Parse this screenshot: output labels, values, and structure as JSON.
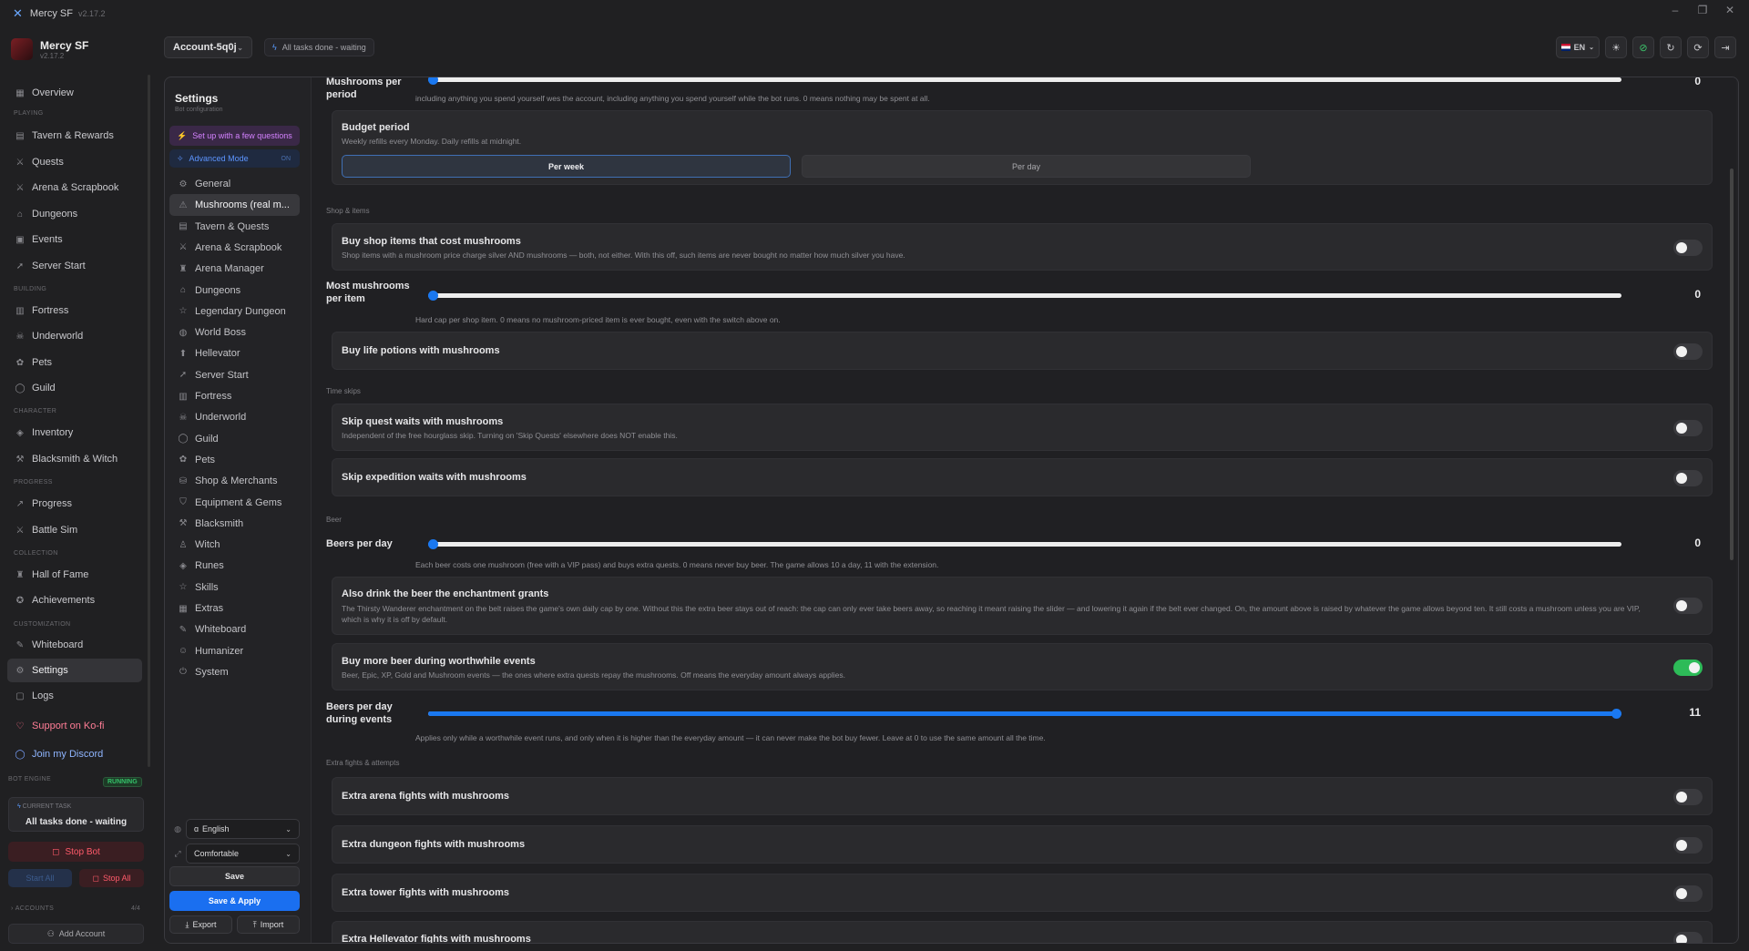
{
  "app": {
    "title": "Mercy SF",
    "version": "v2.17.2"
  },
  "profile": {
    "name": "Mercy SF",
    "version": "v2.17.2"
  },
  "header": {
    "account": "Account-5q0j",
    "status": "All tasks done - waiting",
    "lang": "EN"
  },
  "sidebar": {
    "overview": "Overview",
    "playing": "PLAYING",
    "tavern": "Tavern & Rewards",
    "quests": "Quests",
    "arena": "Arena & Scrapbook",
    "dungeons": "Dungeons",
    "events": "Events",
    "server_start": "Server Start",
    "building": "BUILDING",
    "fortress": "Fortress",
    "underworld": "Underworld",
    "pets": "Pets",
    "guild": "Guild",
    "character": "CHARACTER",
    "inventory": "Inventory",
    "blacksmith": "Blacksmith & Witch",
    "progress_sec": "PROGRESS",
    "progress": "Progress",
    "battle_sim": "Battle Sim",
    "collection": "COLLECTION",
    "hall_of_fame": "Hall of Fame",
    "achievements": "Achievements",
    "customization": "CUSTOMIZATION",
    "whiteboard": "Whiteboard",
    "settings": "Settings",
    "logs": "Logs",
    "kofi": "Support on Ko-fi",
    "discord": "Join my Discord"
  },
  "bot": {
    "engine_label": "BOT ENGINE",
    "running": "RUNNING",
    "current_task_label": "CURRENT TASK",
    "current_task": "All tasks done - waiting",
    "stop_bot": "Stop Bot",
    "start_all": "Start All",
    "stop_all": "Stop All",
    "accounts_label": "ACCOUNTS",
    "accounts_count": "4/4",
    "add_account": "Add Account"
  },
  "settings_nav": {
    "title": "Settings",
    "subtitle": "Bot configuration",
    "setup": "Set up with a few questions",
    "advanced": "Advanced Mode",
    "advanced_state": "ON",
    "items": [
      "General",
      "Mushrooms (real m...",
      "Tavern & Quests",
      "Arena & Scrapbook",
      "Arena Manager",
      "Dungeons",
      "Legendary Dungeon",
      "World Boss",
      "Hellevator",
      "Server Start",
      "Fortress",
      "Underworld",
      "Guild",
      "Pets",
      "Shop & Merchants",
      "Equipment & Gems",
      "Blacksmith",
      "Witch",
      "Runes",
      "Skills",
      "Extras",
      "Whiteboard",
      "Humanizer",
      "System"
    ],
    "language": "English",
    "density": "Comfortable",
    "save": "Save",
    "save_apply": "Save & Apply",
    "export": "Export",
    "import": "Import"
  },
  "content": {
    "mushrooms_per_period": {
      "label": "Mushrooms per period",
      "value": "0",
      "desc": "including anything you spend yourself wes the account, including anything you spend yourself while the bot runs. 0 means nothing may be spent at all."
    },
    "budget": {
      "title": "Budget period",
      "desc": "Weekly refills every Monday. Daily refills at midnight.",
      "per_week": "Per week",
      "per_day": "Per day"
    },
    "sec_shop": "Shop & items",
    "buy_shop": {
      "title": "Buy shop items that cost mushrooms",
      "desc": "Shop items with a mushroom price charge silver AND mushrooms — both, not either. With this off, such items are never bought no matter how much silver you have."
    },
    "most_per_item": {
      "label": "Most mushrooms per item",
      "value": "0",
      "desc": "Hard cap per shop item. 0 means no mushroom-priced item is ever bought, even with the switch above on."
    },
    "life_potions": {
      "title": "Buy life potions with mushrooms"
    },
    "sec_time": "Time skips",
    "skip_quest": {
      "title": "Skip quest waits with mushrooms",
      "desc": "Independent of the free hourglass skip. Turning on 'Skip Quests' elsewhere does NOT enable this."
    },
    "skip_expedition": {
      "title": "Skip expedition waits with mushrooms"
    },
    "sec_beer": "Beer",
    "beers_per_day": {
      "label": "Beers per day",
      "value": "0",
      "desc": "Each beer costs one mushroom (free with a VIP pass) and buys extra quests. 0 means never buy beer. The game allows 10 a day, 11 with the extension."
    },
    "enchant_beer": {
      "title": "Also drink the beer the enchantment grants",
      "desc": "The Thirsty Wanderer enchantment on the belt raises the game's own daily cap by one. Without this the extra beer stays out of reach: the cap can only ever take beers away, so reaching it meant raising the slider — and lowering it again if the belt ever changed. On, the amount above is raised by whatever the game allows beyond ten. It still costs a mushroom unless you are VIP, which is why it is off by default."
    },
    "worthwhile": {
      "title": "Buy more beer during worthwhile events",
      "desc": "Beer, Epic, XP, Gold and Mushroom events — the ones where extra quests repay the mushrooms. Off means the everyday amount always applies."
    },
    "beers_events": {
      "label": "Beers per day during events",
      "value": "11",
      "desc": "Applies only while a worthwhile event runs, and only when it is higher than the everyday amount — it can never make the bot buy fewer. Leave at 0 to use the same amount all the time."
    },
    "sec_extra": "Extra fights & attempts",
    "extra_arena": {
      "title": "Extra arena fights with mushrooms"
    },
    "extra_dungeon": {
      "title": "Extra dungeon fights with mushrooms"
    },
    "extra_tower": {
      "title": "Extra tower fights with mushrooms"
    },
    "extra_hellevator": {
      "title": "Extra Hellevator fights with mushrooms"
    }
  },
  "sliders": {
    "mushrooms_per_period": 0,
    "most_per_item": 0,
    "beers_per_day": 0,
    "beers_events": 11,
    "beers_max": 11
  },
  "toggles": {
    "buy_shop": false,
    "life_potions": false,
    "skip_quest": false,
    "skip_expedition": false,
    "enchant_beer": false,
    "worthwhile": true,
    "extra_arena": false,
    "extra_dungeon": false,
    "extra_tower": false,
    "extra_hellevator": false
  },
  "colors": {
    "accent": "#1a78f0",
    "toggle_on": "#2dbb58",
    "danger": "#ff5a6a"
  }
}
